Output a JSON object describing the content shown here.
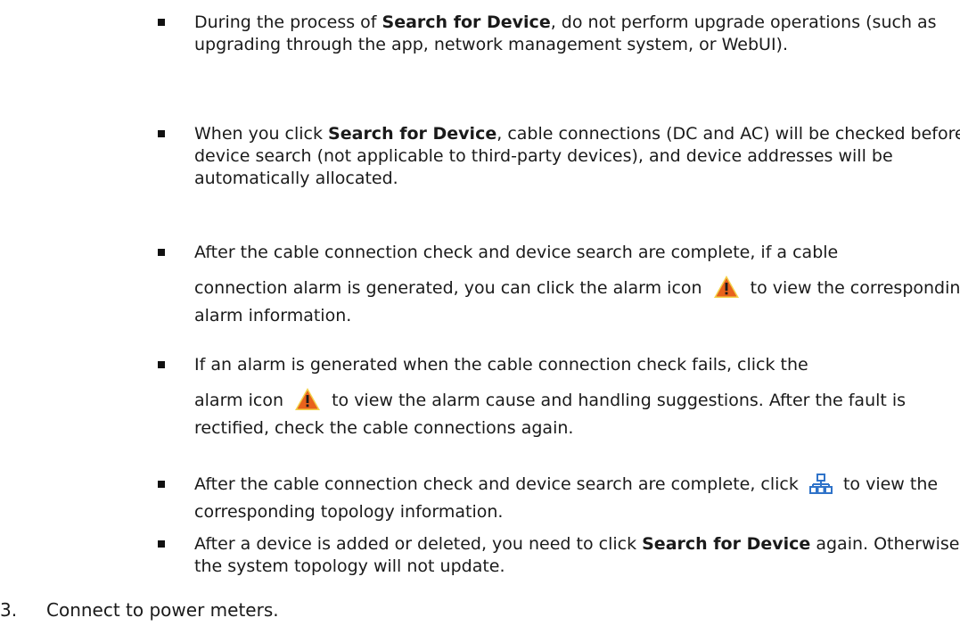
{
  "bullets": [
    {
      "text_before": "During the process of ",
      "bold": "Search for Device",
      "text_after": ", do not perform upgrade operations (such as upgrading through the app, network management system, or WebUI)."
    },
    {
      "text_before": "When you click ",
      "bold": "Search for Device",
      "text_after": ", cable connections (DC and AC) will be checked before device search (not applicable to third-party devices), and device addresses will be automatically allocated."
    },
    {
      "line1": "After the cable connection check and device search are complete, if a cable",
      "text_before": "connection alarm is generated, you can click the alarm icon",
      "icon": "warning-triangle-icon",
      "text_after": "to view the corresponding alarm information."
    },
    {
      "line1": "If an alarm is generated when the cable connection check fails, click the",
      "text_before": "alarm icon",
      "icon": "warning-triangle-icon",
      "text_after": "to view the alarm cause and handling suggestions. After the fault is rectified, check the cable connections again."
    },
    {
      "text_before": "After the cable connection check and device search are complete, click",
      "icon": "topology-icon",
      "text_after": "to view the corresponding topology information."
    },
    {
      "text_before": "After a device is added or deleted, you need to click ",
      "bold": "Search for Device",
      "text_after": " again. Otherwise, the system topology will not update."
    }
  ],
  "step": {
    "number": "3.",
    "text": "Connect to power meters."
  },
  "colors": {
    "warning_fill": "#e8621c",
    "warning_border": "#f3d24a",
    "topology_icon": "#2f73c9"
  }
}
